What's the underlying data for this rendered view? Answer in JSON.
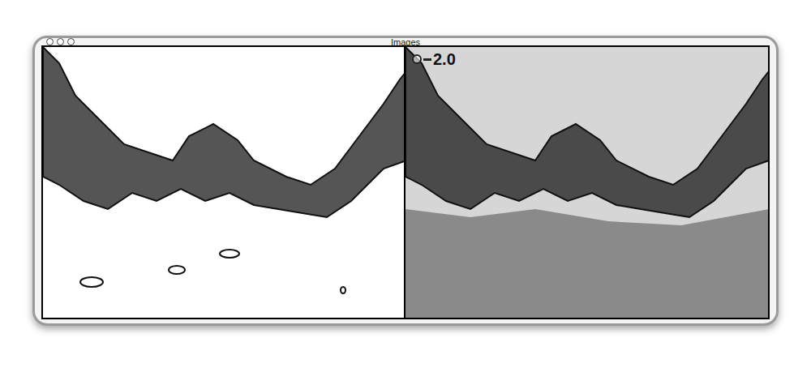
{
  "window": {
    "title": "Images"
  },
  "overlay": {
    "label": "2.0"
  }
}
